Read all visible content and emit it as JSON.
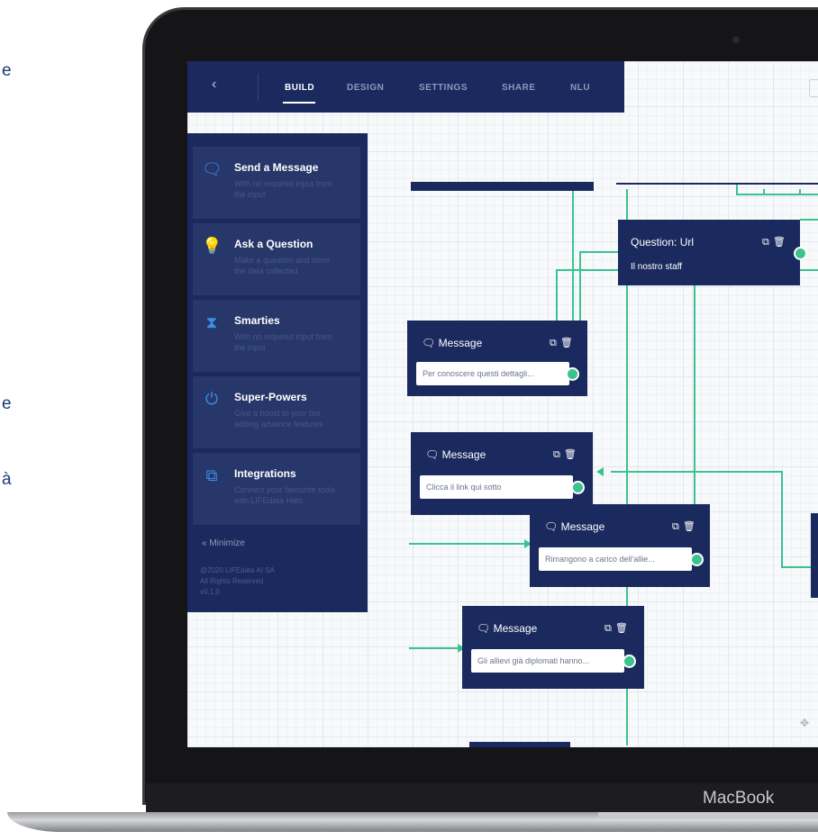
{
  "page_fragments": {
    "line1": "e",
    "line2": "e",
    "line3": "à"
  },
  "laptop": {
    "brand": "MacBook"
  },
  "topnav": {
    "back_label": "‹",
    "tabs": [
      {
        "label": "BUILD",
        "active": true
      },
      {
        "label": "DESIGN",
        "active": false
      },
      {
        "label": "SETTINGS",
        "active": false
      },
      {
        "label": "SHARE",
        "active": false
      },
      {
        "label": "NLU",
        "active": false
      }
    ]
  },
  "sidebar": {
    "items": [
      {
        "icon": "chat-bubbles-icon",
        "glyph": "🗨",
        "title": "Send a Message",
        "desc": "With no required input from the input"
      },
      {
        "icon": "lightbulb-icon",
        "glyph": "💡",
        "title": "Ask a Question",
        "desc": "Make a question and store the data collected"
      },
      {
        "icon": "hourglass-icon",
        "glyph": "⧗",
        "title": "Smarties",
        "desc": "With no required input from the input"
      },
      {
        "icon": "power-icon",
        "glyph": "⏻",
        "title": "Super-Powers",
        "desc": "Give a boost to your bot adding advance features"
      },
      {
        "icon": "puzzle-icon",
        "glyph": "⧉",
        "title": "Integrations",
        "desc": "Connect your favourite tools with LIFEdata Halo"
      }
    ],
    "minimize_label": "« Minimize",
    "copyright": [
      "@2020 LIFEdata AI SA",
      "All Rights Reserved",
      "v0.1.0"
    ]
  },
  "flow": {
    "question_node": {
      "title": "Question: Url",
      "subtitle": "Il nostro staff",
      "actions": "⧉🗑"
    },
    "message_nodes": [
      {
        "title": "Message",
        "text": "Per conoscere questi dettagli...",
        "actions": "⧉🗑"
      },
      {
        "title": "Message",
        "text": "Clicca il link qui sotto",
        "actions": "⧉🗑"
      },
      {
        "title": "Message",
        "text": "Rimangono a carico dell'allie...",
        "actions": "⧉🗑"
      },
      {
        "title": "Message",
        "text": "Gli allievi già diplomati hanno...",
        "actions": "⧉🗑"
      }
    ]
  },
  "colors": {
    "navy": "#1b2a5e",
    "accent_green": "#3bc28d",
    "sidebar_card": "#273769",
    "icon_blue": "#3b8ee8"
  }
}
